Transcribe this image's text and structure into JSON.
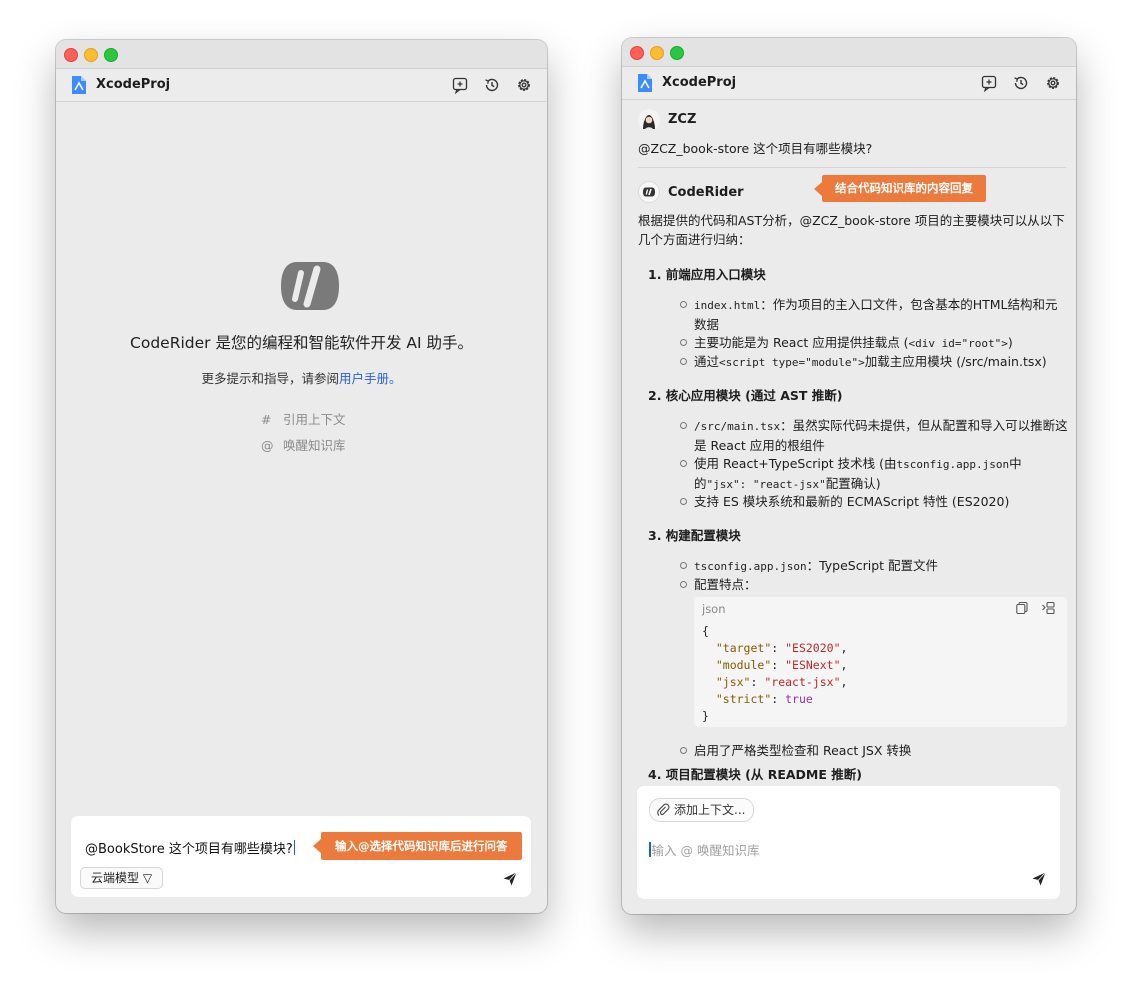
{
  "app_title": "XcodeProj",
  "colors": {
    "accent": "#2a5ee8",
    "callout": "#ec7a3d"
  },
  "left": {
    "welcome_title": "CodeRider 是您的编程和智能软件开发 AI 助手。",
    "welcome_sub_prefix": "更多提示和指导，请参阅",
    "welcome_sub_link": "用户手册。",
    "hints": [
      {
        "symbol": "#",
        "label": "引用上下文"
      },
      {
        "symbol": "@",
        "label": "唤醒知识库"
      }
    ],
    "input_value": "@BookStore 这个项目有哪些模块?",
    "model_button": "云端模型 ▽",
    "callout": "输入@选择代码知识库后进行问答"
  },
  "right": {
    "user_name": "ZCZ",
    "user_question": "@ZCZ_book-store 这个项目有哪些模块?",
    "bot_name": "CodeRider",
    "callout": "结合代码知识库的内容回复",
    "intro": "根据提供的代码和AST分析，@ZCZ_book-store 项目的主要模块可以从以下几个方面进行归纳：",
    "sections": [
      {
        "title": "1.  前端应用入口模块",
        "items": [
          {
            "code": "index.html",
            "text": "：作为项目的主入口文件，包含基本的HTML结构和元数据"
          },
          {
            "pre": "主要功能是为 React 应用提供挂载点 (",
            "code": "<div id=\"root\">",
            "post": ")"
          },
          {
            "pre": "通过",
            "code": "<script type=\"module\">",
            "post": "加载主应用模块 (/src/main.tsx)"
          }
        ]
      },
      {
        "title": "2.  核心应用模块 (通过 AST 推断)",
        "items": [
          {
            "code": "/src/main.tsx",
            "text": "：虽然实际代码未提供，但从配置和导入可以推断这是 React 应用的根组件"
          },
          {
            "pre": "使用 React+TypeScript 技术栈 (由",
            "code": "tsconfig.app.json",
            "mid": "中的",
            "code2": "\"jsx\": \"react-jsx\"",
            "post": "配置确认)"
          },
          {
            "text": "支持 ES 模块系统和最新的 ECMAScript 特性 (ES2020)"
          }
        ]
      },
      {
        "title": "3.  构建配置模块",
        "items": [
          {
            "code": "tsconfig.app.json",
            "text": "：TypeScript 配置文件"
          },
          {
            "text": "配置特点："
          },
          {
            "text": "启用了严格类型检查和 React JSX 转换"
          }
        ]
      },
      {
        "title": "4.  项目配置模块 (从 README 推断)"
      }
    ],
    "code_block": {
      "lang": "json",
      "entries": [
        {
          "key": "\"target\"",
          "value": "\"ES2020\"",
          "kind": "string"
        },
        {
          "key": "\"module\"",
          "value": "\"ESNext\"",
          "kind": "string"
        },
        {
          "key": "\"jsx\"",
          "value": "\"react-jsx\"",
          "kind": "string"
        },
        {
          "key": "\"strict\"",
          "value": "true",
          "kind": "bool"
        }
      ]
    },
    "add_context": "添加上下文...",
    "input_placeholder": "输入 @ 唤醒知识库"
  }
}
